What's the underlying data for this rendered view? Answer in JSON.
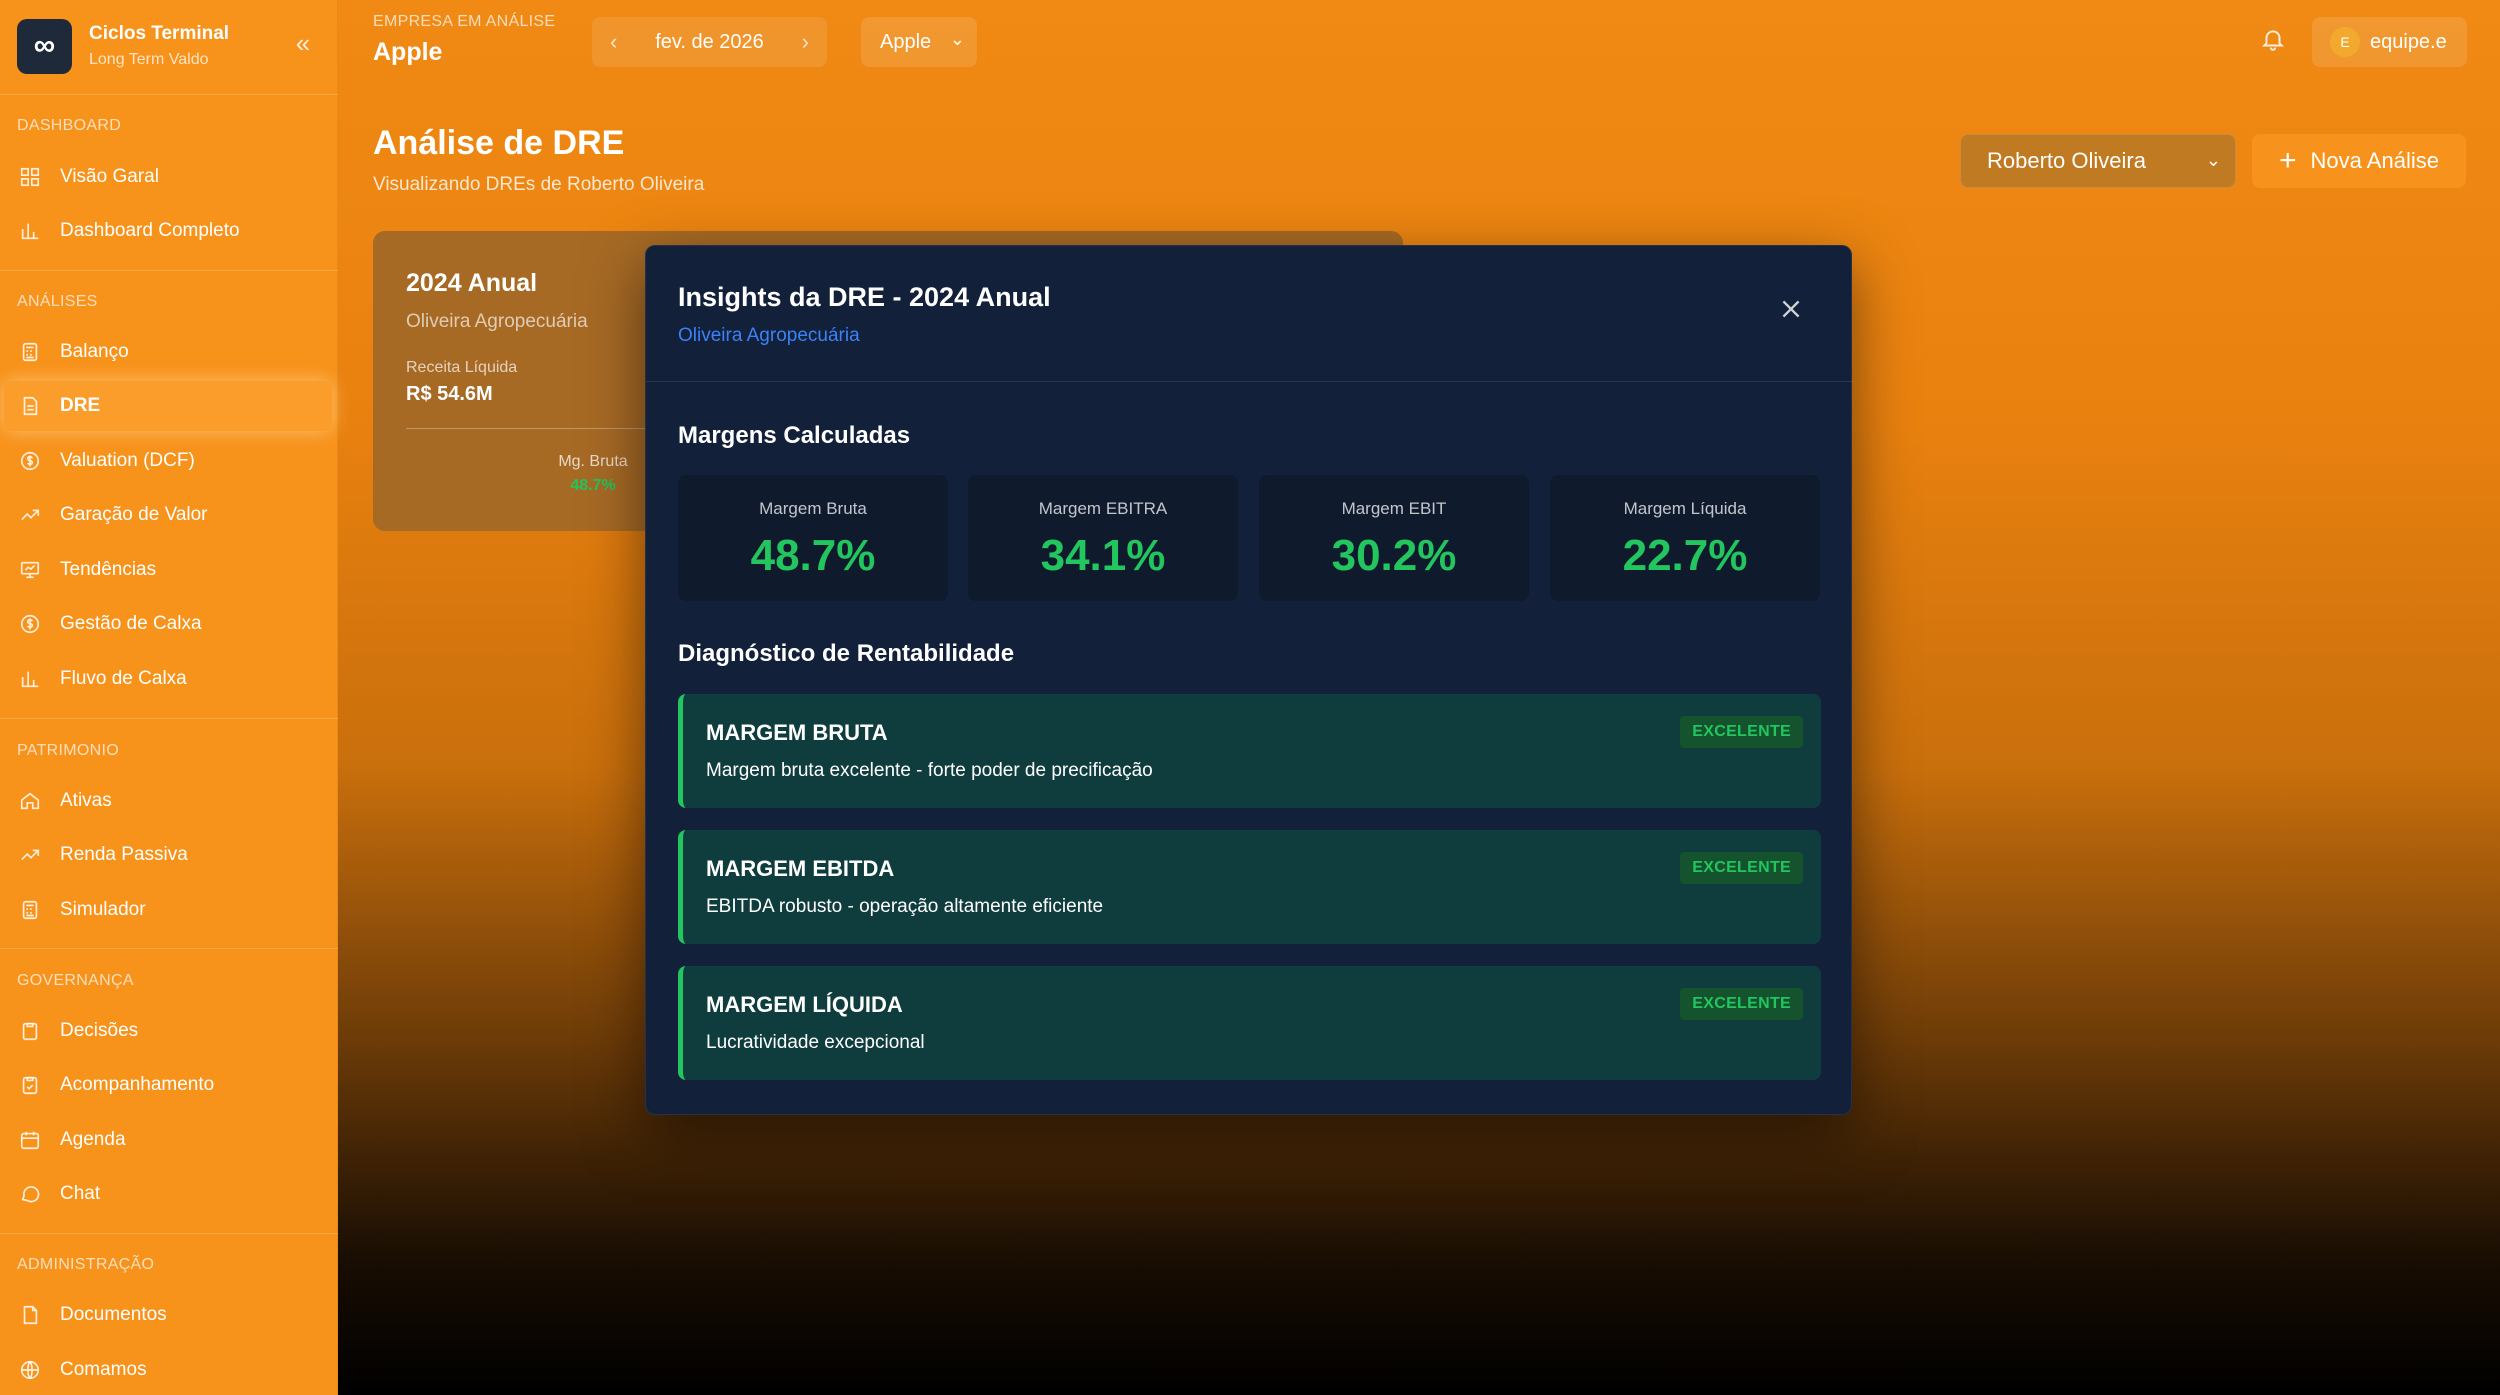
{
  "brand": {
    "title": "Ciclos Terminal",
    "subtitle": "Long Term Valdo",
    "logo_glyph": "∞"
  },
  "sidebar": {
    "sections": [
      {
        "label": "DASHBOARD"
      },
      {
        "label": "ANÁLISES"
      },
      {
        "label": "PATRIMONIO"
      },
      {
        "label": "GOVERNANÇA"
      },
      {
        "label": "ADMINISTRAÇÃO"
      }
    ],
    "items": [
      {
        "label": "Visão Garal",
        "icon": "grid-icon"
      },
      {
        "label": "Dashboard Completo",
        "icon": "bar-chart-icon"
      },
      {
        "label": "Balanço",
        "icon": "calculator-icon"
      },
      {
        "label": "DRE",
        "icon": "file-icon",
        "active": true
      },
      {
        "label": "Valuation (DCF)",
        "icon": "dollar-circle-icon"
      },
      {
        "label": "Garação de Valor",
        "icon": "trending-up-icon"
      },
      {
        "label": "Tendências",
        "icon": "presentation-icon"
      },
      {
        "label": "Gestão de Calxa",
        "icon": "dollar-circle-icon"
      },
      {
        "label": "Fluvo de Calxa",
        "icon": "bar-chart-icon"
      },
      {
        "label": "Ativas",
        "icon": "home-icon"
      },
      {
        "label": "Renda Passiva",
        "icon": "trending-up-icon"
      },
      {
        "label": "Simulador",
        "icon": "calculator-icon"
      },
      {
        "label": "Decisões",
        "icon": "clipboard-icon"
      },
      {
        "label": "Acompanhamento",
        "icon": "clipboard-check-icon"
      },
      {
        "label": "Agenda",
        "icon": "calendar-icon"
      },
      {
        "label": "Chat",
        "icon": "chat-icon"
      },
      {
        "label": "Documentos",
        "icon": "document-icon"
      },
      {
        "label": "Comamos",
        "icon": "globe-icon"
      }
    ]
  },
  "topbar": {
    "label": "EMPRESA EM ANÁLISE",
    "company": "Apple",
    "month": "fev. de 2026",
    "company_select": "Apple",
    "user": "equipe.e",
    "user_initial": "E"
  },
  "page": {
    "title": "Análise de DRE",
    "subtitle": "Visualizando DREs de Roberto Oliveira",
    "user_select": "Roberto Oliveira",
    "new_button": "Nova Análise"
  },
  "card": {
    "title": "2024 Anual",
    "company": "Oliveira Agropecuária",
    "revenue_label": "Receita Líquida",
    "revenue_value": "R$ 54.6M",
    "margin_label": "Mg. Bruta",
    "margin_value": "48.7%"
  },
  "modal": {
    "title": "Insights da DRE - 2024 Anual",
    "subtitle": "Oliveira Agropecuária",
    "margins_heading": "Margens Calculadas",
    "metrics": [
      {
        "label": "Margem Bruta",
        "value": "48.7%"
      },
      {
        "label": "Margem EBITRA",
        "value": "34.1%"
      },
      {
        "label": "Margem EBIT",
        "value": "30.2%"
      },
      {
        "label": "Margem Líquida",
        "value": "22.7%"
      }
    ],
    "diag_heading": "Diagnóstico de Rentabilidade",
    "diagnostics": [
      {
        "title": "MARGEM BRUTA",
        "desc": "Margem bruta excelente - forte poder de precificação",
        "badge": "EXCELENTE"
      },
      {
        "title": "MARGEM EBITDA",
        "desc": "EBITDA robusto - operação altamente eficiente",
        "badge": "EXCELENTE"
      },
      {
        "title": "MARGEM LÍQUIDA",
        "desc": "Lucratividade excepcional",
        "badge": "EXCELENTE"
      }
    ]
  },
  "colors": {
    "accent": "#f7921b",
    "positive": "#22c55e",
    "modal_bg": "#12203a",
    "link": "#3b82f6"
  }
}
